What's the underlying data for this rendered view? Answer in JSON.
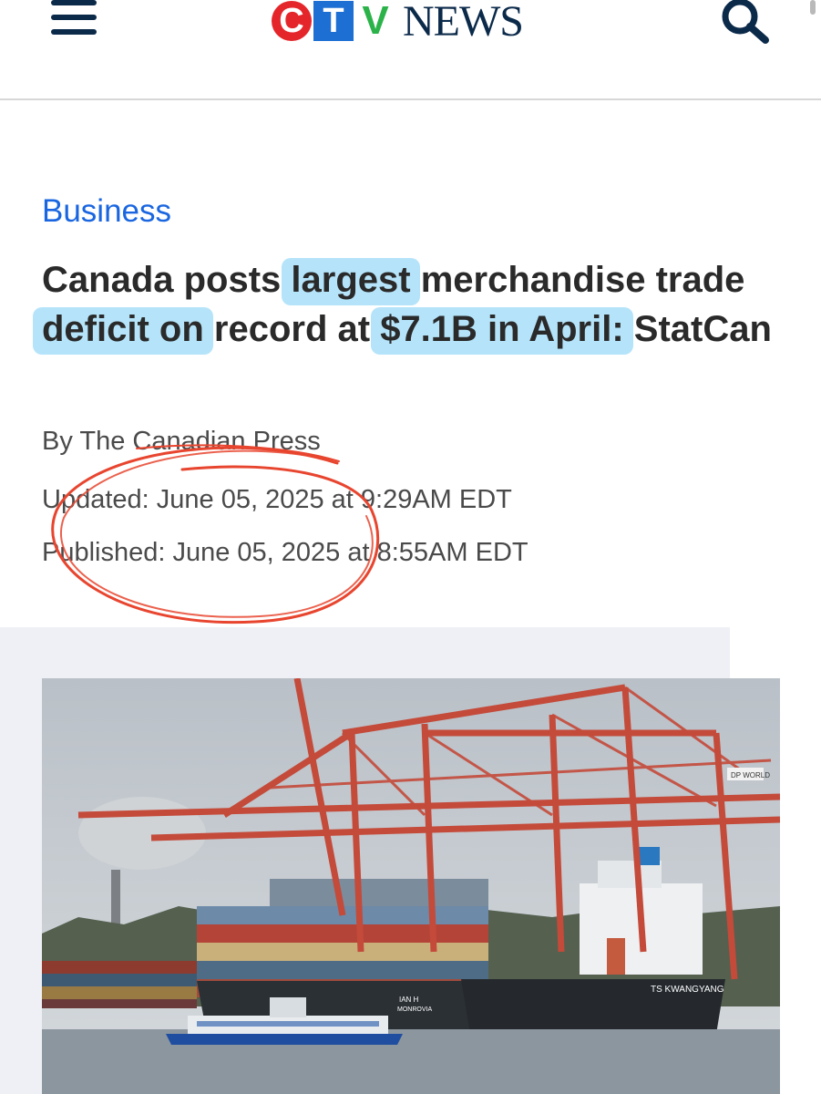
{
  "header": {
    "logo_letters": [
      "C",
      "T",
      "V"
    ],
    "logo_word": "NEWS",
    "logo_colors": {
      "c": "#e4262b",
      "t": "#1d6fd3",
      "v": "#2bb34a",
      "news": "#0b2a4a"
    }
  },
  "article": {
    "section": "Business",
    "headline": {
      "p1": "Canada posts ",
      "h1": "largest",
      "p2": " merchandise trade ",
      "h2": "deficit on",
      "p3": " record at ",
      "h3": "$7.1B in April:",
      "p4": " StatCan"
    },
    "byline": "By The Canadian Press",
    "updated": "Updated: June 05, 2025 at 9:29AM EDT",
    "published": "Published: June 05, 2025 at 8:55AM EDT"
  },
  "image": {
    "ship_name": "TS KWANGYANG",
    "ship_name_2": "IAN H",
    "ship_port": "MONROVIA",
    "crane_sign": "DP WORLD"
  },
  "annotations": {
    "highlight_color": "#78cdf5",
    "circle_color": "#e8452f"
  }
}
